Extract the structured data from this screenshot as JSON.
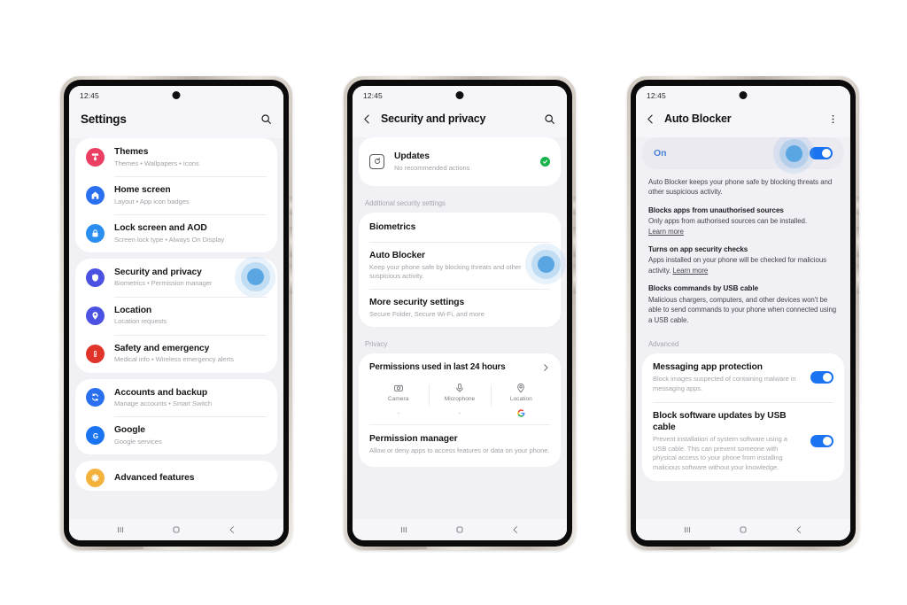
{
  "colors": {
    "accent_blue": "#1a73f0",
    "tap_ring": "#5aa6e2",
    "green_check": "#18b34a",
    "on_label": "#4a82d4",
    "themes_pink": "#ea3e62",
    "home_blue": "#2a6ff0",
    "lock_blue": "#2a8ef0",
    "security_indigo": "#4b51e0",
    "location_indigo": "#4b51e0",
    "safety_red": "#e0342a",
    "accounts_blue": "#2a6ff0",
    "google_blue": "#1a73f0",
    "advanced_amber": "#f3b23c"
  },
  "phones": [
    {
      "id": "settings",
      "status": {
        "time": "12:45"
      },
      "appbar": {
        "title": "Settings",
        "back": false,
        "search_icon": "search-icon",
        "menu_icon": null
      },
      "groups": [
        {
          "items": [
            {
              "icon": "themes-icon",
              "color": "#ea3e62",
              "title": "Themes",
              "subtitle": "Themes  •  Wallpapers  •  Icons"
            },
            {
              "icon": "home-icon",
              "color": "#2a6ff0",
              "title": "Home screen",
              "subtitle": "Layout  •  App icon badges"
            },
            {
              "icon": "lock-icon",
              "color": "#2a8ef0",
              "title": "Lock screen and AOD",
              "subtitle": "Screen lock type  •  Always On Display"
            }
          ]
        },
        {
          "items": [
            {
              "icon": "shield-icon",
              "color": "#4b51e0",
              "title": "Security and privacy",
              "subtitle": "Biometrics  •  Permission manager",
              "tap": true
            },
            {
              "icon": "pin-icon",
              "color": "#4b51e0",
              "title": "Location",
              "subtitle": "Location requests"
            },
            {
              "icon": "alert-icon",
              "color": "#e0342a",
              "title": "Safety and emergency",
              "subtitle": "Medical info  •  Wireless emergency alerts"
            }
          ]
        },
        {
          "items": [
            {
              "icon": "sync-icon",
              "color": "#2a6ff0",
              "title": "Accounts and backup",
              "subtitle": "Manage accounts  •  Smart Switch"
            },
            {
              "icon": "google-icon",
              "color": "#1a73f0",
              "title": "Google",
              "subtitle": "Google services"
            }
          ]
        },
        {
          "items": [
            {
              "icon": "gear-icon",
              "color": "#f3b23c",
              "title": "Advanced features",
              "subtitle": ""
            }
          ]
        }
      ],
      "nav": {
        "recents": "recents-icon",
        "home": "home-button-icon",
        "back": "back-icon"
      }
    },
    {
      "id": "security-and-privacy",
      "status": {
        "time": "12:45"
      },
      "appbar": {
        "title": "Security and privacy",
        "back": true,
        "search_icon": "search-icon",
        "menu_icon": null
      },
      "updates": {
        "icon": "update-icon",
        "title": "Updates",
        "subtitle": "No recommended actions",
        "status_icon": "green-check-icon"
      },
      "section_additional": "Additional security settings",
      "additional_items": [
        {
          "title": "Biometrics",
          "subtitle": ""
        },
        {
          "title": "Auto Blocker",
          "subtitle": "Keep your phone safe by blocking threats and other suspicious activity.",
          "tap": true
        },
        {
          "title": "More security settings",
          "subtitle": "Secure Folder, Secure Wi-Fi, and more"
        }
      ],
      "section_privacy": "Privacy",
      "permissions": {
        "header": "Permissions used in last 24 hours",
        "chevron": "chevron-right-icon",
        "columns": [
          {
            "icon": "camera-icon",
            "name": "Camera",
            "value": "-"
          },
          {
            "icon": "microphone-icon",
            "name": "Microphone",
            "value": "-"
          },
          {
            "icon": "location-pin-icon",
            "name": "Location",
            "value": "google-g-icon"
          }
        ]
      },
      "permission_manager": {
        "title": "Permission manager",
        "subtitle": "Allow or deny apps to access features or data on your phone."
      },
      "nav": {
        "recents": "recents-icon",
        "home": "home-button-icon",
        "back": "back-icon"
      }
    },
    {
      "id": "auto-blocker",
      "status": {
        "time": "12:45"
      },
      "appbar": {
        "title": "Auto Blocker",
        "back": true,
        "search_icon": null,
        "menu_icon": "more-vertical-icon"
      },
      "hero_toggle": {
        "label": "On",
        "state": "on"
      },
      "intro": "Auto Blocker keeps your phone safe by blocking threats and other suspicious activity.",
      "features": [
        {
          "heading": "Blocks apps from unauthorised sources",
          "body": "Only apps from authorised sources can be installed. ",
          "link": "Learn more",
          "link_inline": false
        },
        {
          "heading": "Turns on app security checks",
          "body": "Apps installed on your phone will be checked for malicious activity. ",
          "link": "Learn more",
          "link_inline": true
        },
        {
          "heading": "Blocks commands by USB cable",
          "body": "Malicious chargers, computers, and other devices won't be able to send commands to your phone when connected using a USB cable.",
          "link": "",
          "link_inline": false
        }
      ],
      "section_advanced": "Advanced",
      "advanced_items": [
        {
          "title": "Messaging app protection",
          "subtitle": "Block images suspected of containing malware in messaging apps.",
          "state": "on"
        },
        {
          "title": "Block software updates by USB cable",
          "subtitle": "Prevent installation of system software using a USB cable. This can prevent someone with physical access to your phone from installing malicious software without your knowledge.",
          "state": "on"
        }
      ],
      "nav": {
        "recents": "recents-icon",
        "home": "home-button-icon",
        "back": "back-icon"
      }
    }
  ]
}
